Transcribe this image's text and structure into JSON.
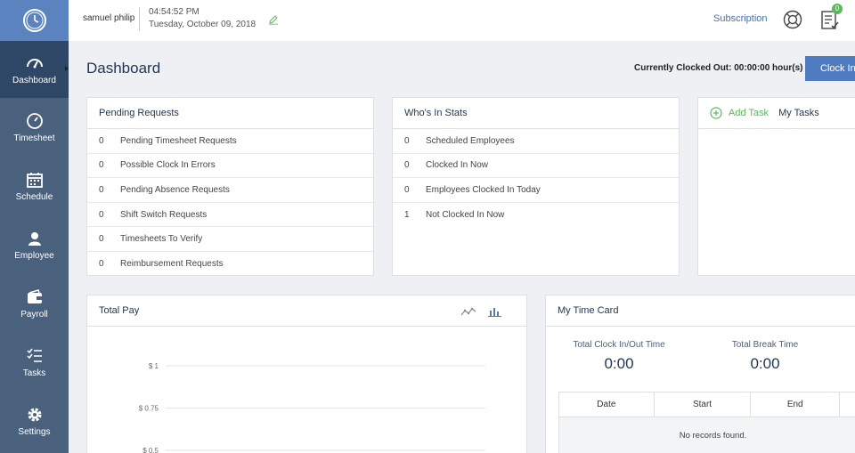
{
  "sidebar": {
    "items": [
      {
        "label": "Dashboard",
        "icon": "speedometer-icon"
      },
      {
        "label": "Timesheet",
        "icon": "clock-icon"
      },
      {
        "label": "Schedule",
        "icon": "calendar-icon"
      },
      {
        "label": "Employee",
        "icon": "person-icon"
      },
      {
        "label": "Payroll",
        "icon": "wallet-icon"
      },
      {
        "label": "Tasks",
        "icon": "checklist-icon"
      },
      {
        "label": "Settings",
        "icon": "gear-icon"
      }
    ]
  },
  "header": {
    "user_name": "samuel philip",
    "time": "04:54:52 PM",
    "date": "Tuesday, October 09, 2018",
    "subscription_label": "Subscription",
    "notification_count": "0"
  },
  "page": {
    "title": "Dashboard",
    "clock_status": "Currently Clocked Out: 00:00:00 hour(s)",
    "clock_button": "Clock In"
  },
  "pending_requests": {
    "title": "Pending Requests",
    "rows": [
      {
        "count": "0",
        "label": "Pending Timesheet Requests"
      },
      {
        "count": "0",
        "label": "Possible Clock In Errors"
      },
      {
        "count": "0",
        "label": "Pending Absence Requests"
      },
      {
        "count": "0",
        "label": "Shift Switch Requests"
      },
      {
        "count": "0",
        "label": "Timesheets To Verify"
      },
      {
        "count": "0",
        "label": "Reimbursement Requests"
      }
    ]
  },
  "whos_in": {
    "title": "Who's In Stats",
    "rows": [
      {
        "count": "0",
        "label": "Scheduled Employees"
      },
      {
        "count": "0",
        "label": "Clocked In Now"
      },
      {
        "count": "0",
        "label": "Employees Clocked In Today"
      },
      {
        "count": "1",
        "label": "Not Clocked In Now"
      }
    ]
  },
  "tasks": {
    "add_label": "Add Task",
    "my_tasks_label": "My Tasks"
  },
  "total_pay": {
    "title": "Total Pay"
  },
  "chart_data": {
    "type": "line",
    "title": "",
    "xlabel": "",
    "ylabel": "",
    "y_tick_labels": [
      "$ 1",
      "$ 0.75",
      "$ 0.5"
    ],
    "y_ticks": [
      1,
      0.75,
      0.5
    ],
    "series": []
  },
  "time_card": {
    "title": "My Time Card",
    "total_clock_label": "Total Clock In/Out Time",
    "total_clock_value": "0:00",
    "total_break_label": "Total Break Time",
    "total_break_value": "0:00",
    "columns": [
      "Date",
      "Start",
      "End"
    ],
    "empty_message": "No records found."
  },
  "colors": {
    "sidebar": "#4a617e",
    "sidebar_active": "#2f4766",
    "accent": "#4f7cc0",
    "success": "#5cb85c"
  }
}
